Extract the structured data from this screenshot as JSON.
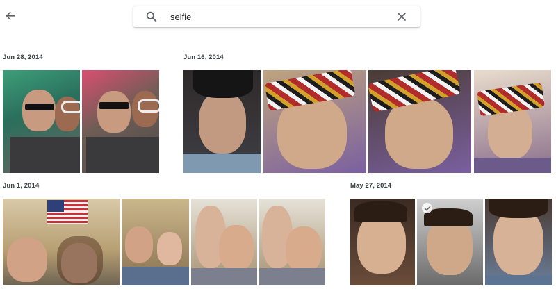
{
  "search": {
    "query": "selfie"
  },
  "icons": {
    "back": "arrow-left-icon",
    "search": "search-icon",
    "clear": "close-icon",
    "selected": "check-circle-icon"
  },
  "sections": [
    {
      "date": "Jun 28, 2014"
    },
    {
      "date": "Jun 16, 2014"
    },
    {
      "date": "Jun 1, 2014"
    },
    {
      "date": "May 27, 2014"
    }
  ],
  "colors": {
    "icon": "#5f6368",
    "date_text": "#3c4043"
  }
}
